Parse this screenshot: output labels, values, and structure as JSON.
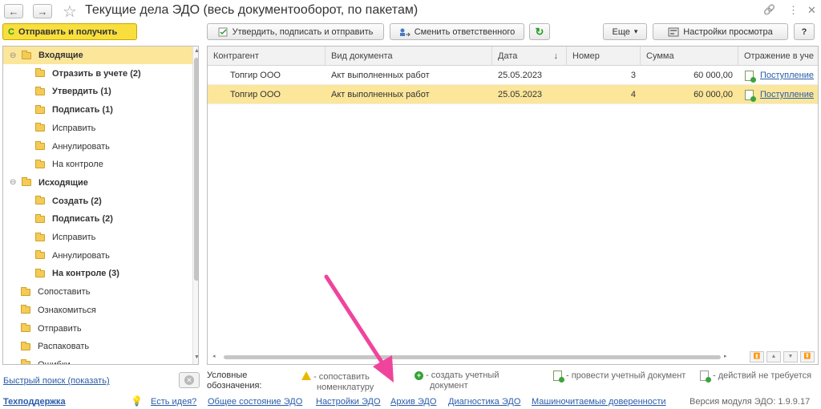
{
  "window": {
    "title": "Текущие дела ЭДО (весь документооборот, по пакетам)",
    "back_icon": "←",
    "forward_icon": "→",
    "star_icon": "☆",
    "link_icon": "🔗",
    "more_icon": "⋮",
    "close_icon": "✕"
  },
  "toolbar": {
    "send_receive": "Отправить и получить",
    "approve_sign_send": "Утвердить, подписать и отправить",
    "change_responsible": "Сменить ответственного",
    "more": "Еще",
    "more_arrow": "▾",
    "view_settings": "Настройки просмотра",
    "help": "?"
  },
  "tree": {
    "items": [
      {
        "label": "Входящие",
        "bold": true,
        "level": 0,
        "expander": "⊖",
        "selected": true
      },
      {
        "label": "Отразить в учете (2)",
        "bold": true,
        "level": 1
      },
      {
        "label": "Утвердить (1)",
        "bold": true,
        "level": 1
      },
      {
        "label": "Подписать (1)",
        "bold": true,
        "level": 1
      },
      {
        "label": "Исправить",
        "bold": false,
        "level": 1
      },
      {
        "label": "Аннулировать",
        "bold": false,
        "level": 1
      },
      {
        "label": "На контроле",
        "bold": false,
        "level": 1
      },
      {
        "label": "Исходящие",
        "bold": true,
        "level": 0,
        "expander": "⊖"
      },
      {
        "label": "Создать (2)",
        "bold": true,
        "level": 1
      },
      {
        "label": "Подписать (2)",
        "bold": true,
        "level": 1
      },
      {
        "label": "Исправить",
        "bold": false,
        "level": 1
      },
      {
        "label": "Аннулировать",
        "bold": false,
        "level": 1
      },
      {
        "label": "На контроле (3)",
        "bold": true,
        "level": 1
      },
      {
        "label": "Сопоставить",
        "bold": false,
        "level": 0
      },
      {
        "label": "Ознакомиться",
        "bold": false,
        "level": 0
      },
      {
        "label": "Отправить",
        "bold": false,
        "level": 0
      },
      {
        "label": "Распаковать",
        "bold": false,
        "level": 0
      },
      {
        "label": "Ошибки",
        "bold": false,
        "level": 0
      }
    ]
  },
  "table": {
    "columns": [
      "Контрагент",
      "Вид документа",
      "Дата",
      "Номер",
      "Сумма",
      "Отражение в уче"
    ],
    "sort_indicator": "↓",
    "rows": [
      {
        "counterparty": "Топгир ООО",
        "doc_type": "Акт выполненных работ",
        "date": "25.05.2023",
        "number": "3",
        "sum": "60 000,00",
        "reflection": "Поступление"
      },
      {
        "counterparty": "Топгир ООО",
        "doc_type": "Акт выполненных работ",
        "date": "25.05.2023",
        "number": "4",
        "sum": "60 000,00",
        "reflection": "Поступление",
        "selected": true
      }
    ]
  },
  "search": {
    "quick_search": "Быстрый поиск (показать)"
  },
  "legend": {
    "title_line1": "Условные",
    "title_line2": "обозначения:",
    "match_line1": "- сопоставить",
    "match_line2": "номенклатуру",
    "create_line1": "- создать учетный",
    "create_line2": "документ",
    "post": "- провести учетный документ",
    "no_action": "- действий не требуется"
  },
  "footer": {
    "support": "Техподдержка",
    "idea": "Есть идея?",
    "links": [
      "Общее состояние ЭДО",
      "Настройки ЭДО",
      "Архив ЭДО",
      "Диагностика ЭДО",
      "Машиночитаемые доверенности"
    ],
    "version": "Версия модуля ЭДО: 1.9.9.17"
  },
  "colors": {
    "accent_yellow": "#f8df3e",
    "selection": "#fbe69a",
    "link": "#2a5ca8",
    "annotation_arrow": "#f0449c"
  }
}
